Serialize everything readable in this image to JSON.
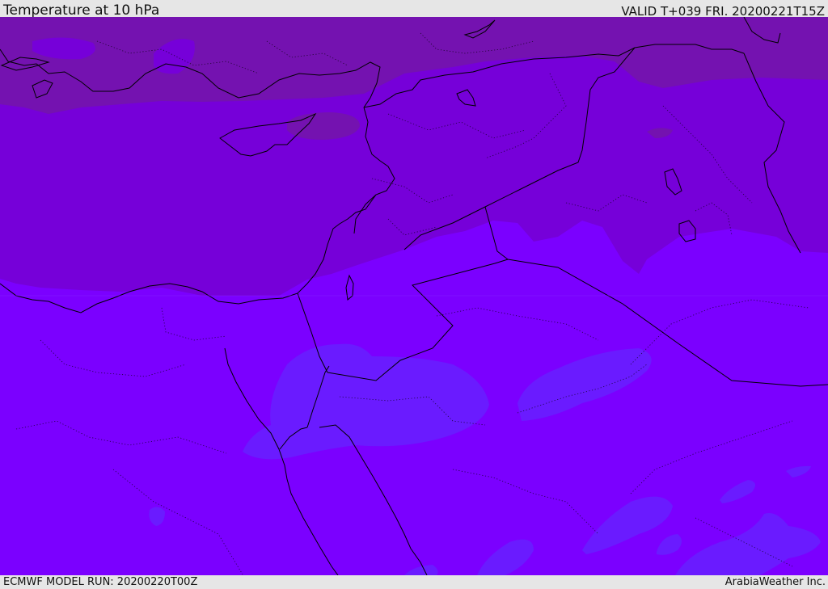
{
  "header": {
    "title": "Temperature at 10 hPa",
    "valid": "VALID T+039 FRI. 20200221T15Z"
  },
  "footer": {
    "model_run": "ECMWF MODEL RUN: 20200220T00Z",
    "credit": "ArabiaWeather Inc."
  },
  "map": {
    "field": "temperature",
    "level": "10 hPa",
    "colors": {
      "field_cold": "#7b00ff",
      "field_mid": "#7600d9",
      "field_warm": "#7412b0",
      "field_light": "#6a1bff",
      "coastline": "#000000",
      "frame": "#e6e6e6"
    }
  }
}
